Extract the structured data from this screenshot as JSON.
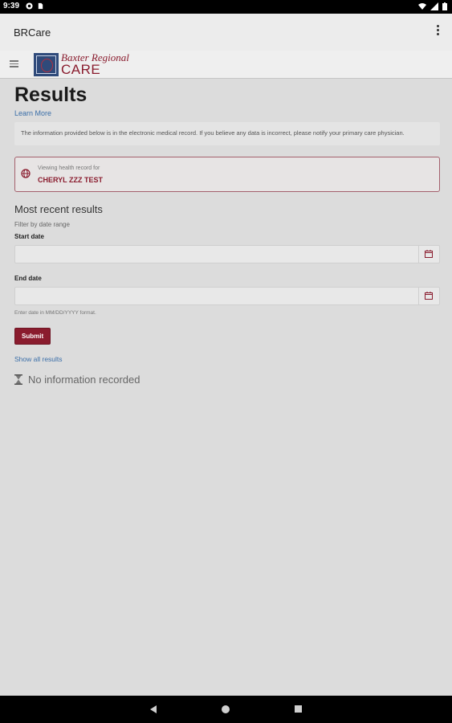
{
  "status_bar": {
    "time": "9:39"
  },
  "app_bar": {
    "title": "BRCare"
  },
  "logo": {
    "line1": "Baxter Regional",
    "line2": "CARE"
  },
  "page": {
    "title": "Results",
    "learn_more": "Learn More",
    "notice": "The information provided below is in the electronic medical record. If you believe any data is incorrect, please notify your primary care physician.",
    "viewing_label": "Viewing health record for",
    "patient_name": "CHERYL ZZZ TEST",
    "section_heading": "Most recent results",
    "filter_label": "Filter by date range",
    "start_date_label": "Start date",
    "start_date_value": "",
    "end_date_label": "End date",
    "end_date_value": "",
    "date_hint": "Enter date in MM/DD/YYYY format.",
    "submit_label": "Submit",
    "show_all": "Show all results",
    "no_info": "No information recorded"
  },
  "colors": {
    "accent": "#8a1c2e",
    "link": "#3a6ea8",
    "background": "#dcdcdc"
  }
}
